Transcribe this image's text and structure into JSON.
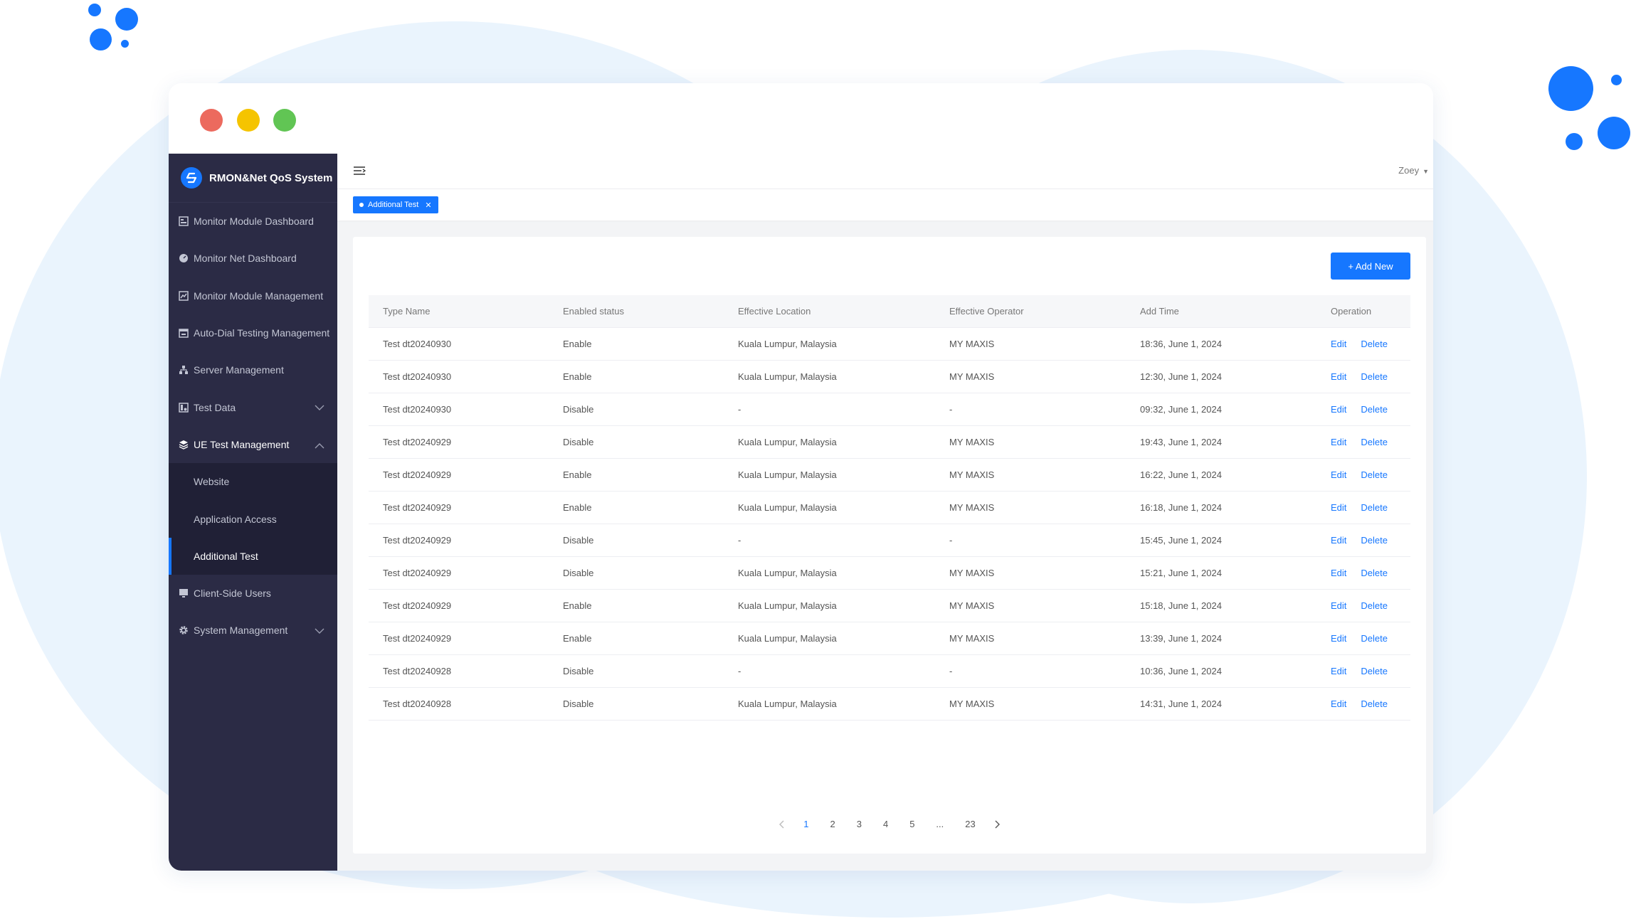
{
  "app": {
    "brand_title": "RMON&Net QoS System",
    "user": "Zoey"
  },
  "colors": {
    "accent": "#1677ff",
    "sidebar_bg": "#2b2b45",
    "traffic_red": "#ec6a5e",
    "traffic_yellow": "#f5c400",
    "traffic_green": "#61c554"
  },
  "sidebar": {
    "items": [
      {
        "label": "Monitor Module Dashboard",
        "icon": "dashboard-icon"
      },
      {
        "label": "Monitor Net Dashboard",
        "icon": "gauge-icon"
      },
      {
        "label": "Monitor Module Management",
        "icon": "chart-icon"
      },
      {
        "label": "Auto-Dial Testing Management",
        "icon": "calendar-icon"
      },
      {
        "label": "Server Management",
        "icon": "network-icon"
      },
      {
        "label": "Test Data",
        "icon": "data-icon"
      },
      {
        "label": "UE Test Management",
        "icon": "layers-icon"
      },
      {
        "label": "Client-Side Users",
        "icon": "monitor-icon"
      },
      {
        "label": "System Management",
        "icon": "gear-icon"
      }
    ],
    "sub_items": [
      {
        "label": "Website"
      },
      {
        "label": "Application Access"
      },
      {
        "label": "Additional Test"
      }
    ]
  },
  "tabs": {
    "active_tab": "Additional Test"
  },
  "toolbar": {
    "add_label": "+ Add New"
  },
  "table": {
    "columns": [
      "Type Name",
      "Enabled status",
      "Effective Location",
      "Effective Operator",
      "Add Time",
      "Operation"
    ],
    "rows": [
      [
        "Test dt20240930",
        "Enable",
        "Kuala Lumpur, Malaysia",
        "MY MAXIS",
        "18:36, June 1, 2024"
      ],
      [
        "Test dt20240930",
        "Enable",
        "Kuala Lumpur, Malaysia",
        "MY MAXIS",
        "12:30, June 1, 2024"
      ],
      [
        "Test dt20240930",
        "Disable",
        "-",
        "-",
        "09:32, June 1, 2024"
      ],
      [
        "Test dt20240929",
        "Disable",
        "Kuala Lumpur, Malaysia",
        "MY MAXIS",
        "19:43, June 1, 2024"
      ],
      [
        "Test dt20240929",
        "Enable",
        "Kuala Lumpur, Malaysia",
        "MY MAXIS",
        "16:22, June 1, 2024"
      ],
      [
        "Test dt20240929",
        "Enable",
        "Kuala Lumpur, Malaysia",
        "MY MAXIS",
        "16:18, June 1, 2024"
      ],
      [
        "Test dt20240929",
        "Disable",
        "-",
        "-",
        "15:45, June 1, 2024"
      ],
      [
        "Test dt20240929",
        "Disable",
        "Kuala Lumpur, Malaysia",
        "MY MAXIS",
        "15:21, June 1, 2024"
      ],
      [
        "Test dt20240929",
        "Enable",
        "Kuala Lumpur, Malaysia",
        "MY MAXIS",
        "15:18, June 1, 2024"
      ],
      [
        "Test dt20240929",
        "Enable",
        "Kuala Lumpur, Malaysia",
        "MY MAXIS",
        "13:39, June 1, 2024"
      ],
      [
        "Test dt20240928",
        "Disable",
        "-",
        "-",
        "10:36, June 1, 2024"
      ],
      [
        "Test dt20240928",
        "Disable",
        "Kuala Lumpur, Malaysia",
        "MY MAXIS",
        "14:31, June 1, 2024"
      ]
    ],
    "edit_label": "Edit",
    "delete_label": "Delete"
  },
  "pagination": {
    "pages": [
      "1",
      "2",
      "3",
      "4",
      "5",
      "...",
      "23"
    ],
    "current": "1"
  }
}
